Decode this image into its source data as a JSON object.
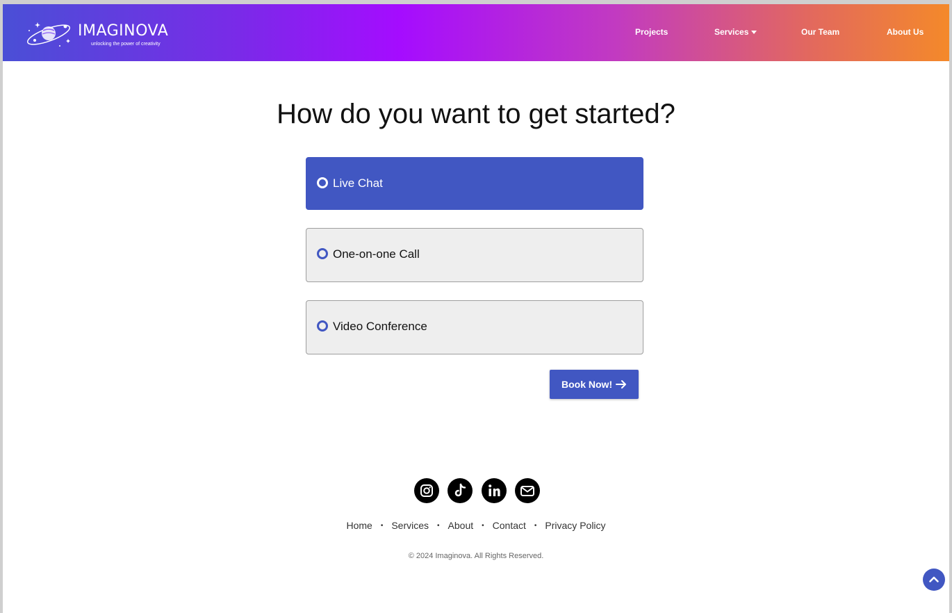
{
  "brand": {
    "name": "IMAGINOVA",
    "tagline": "unlocking the power of creativity"
  },
  "nav": {
    "projects": "Projects",
    "services": "Services",
    "team": "Our Team",
    "about": "About Us"
  },
  "main": {
    "title": "How do you want to get started?",
    "options": [
      {
        "label": "Live Chat",
        "selected": true
      },
      {
        "label": "One-on-one Call",
        "selected": false
      },
      {
        "label": "Video Conference",
        "selected": false
      }
    ],
    "book_label": "Book Now!"
  },
  "social_icons": [
    "instagram-icon",
    "tiktok-icon",
    "linkedin-icon",
    "mail-icon"
  ],
  "footer": {
    "links": [
      "Home",
      "Services",
      "About",
      "Contact",
      "Privacy Policy"
    ],
    "copyright": "© 2024 Imaginova. All Rights Reserved."
  },
  "colors": {
    "accent": "#4157c2",
    "option_bg": "#eeeeee",
    "gradient_start": "#4a4fd6",
    "gradient_mid": "#a50cff",
    "gradient_end": "#f4892a"
  }
}
